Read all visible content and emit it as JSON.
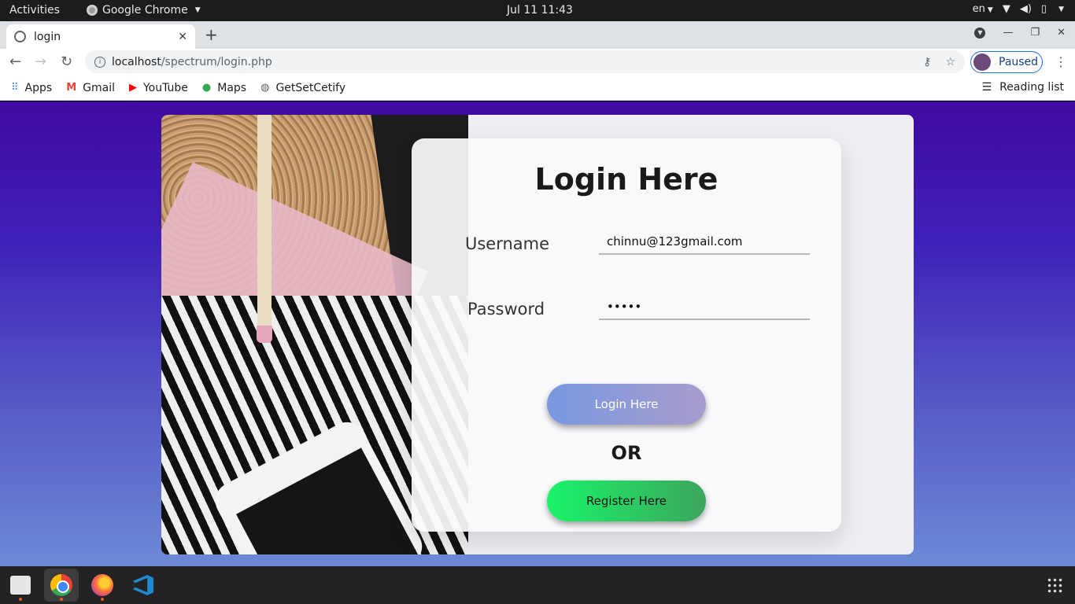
{
  "system": {
    "activities": "Activities",
    "app_menu": "Google Chrome",
    "clock": "Jul 11  11:43",
    "input_lang": "en"
  },
  "browser": {
    "tab_title": "login",
    "url_host": "localhost",
    "url_path": "/spectrum/login.php",
    "profile_status": "Paused",
    "bookmarks": [
      {
        "label": "Apps",
        "icon": "apps-grid-icon"
      },
      {
        "label": "Gmail",
        "icon": "gmail-icon"
      },
      {
        "label": "YouTube",
        "icon": "youtube-icon"
      },
      {
        "label": "Maps",
        "icon": "maps-icon"
      },
      {
        "label": "GetSetCetify",
        "icon": "globe-icon"
      }
    ],
    "reading_list": "Reading list"
  },
  "login": {
    "title": "Login Here",
    "username_label": "Username",
    "username_value": "chinnu@123gmail.com",
    "password_label": "Password",
    "password_value": "•••••",
    "login_button": "Login Here",
    "or_text": "OR",
    "register_button": "Register Here"
  },
  "dock": {
    "apps": [
      "files-icon",
      "chrome-icon",
      "firefox-icon",
      "vscode-icon"
    ],
    "show_apps": "apps-grid-icon"
  },
  "colors": {
    "page_gradient_top": "#3f0aa0",
    "page_gradient_bottom": "#6c8ad6",
    "login_button": "#7898e0",
    "register_button": "#19f46a"
  }
}
